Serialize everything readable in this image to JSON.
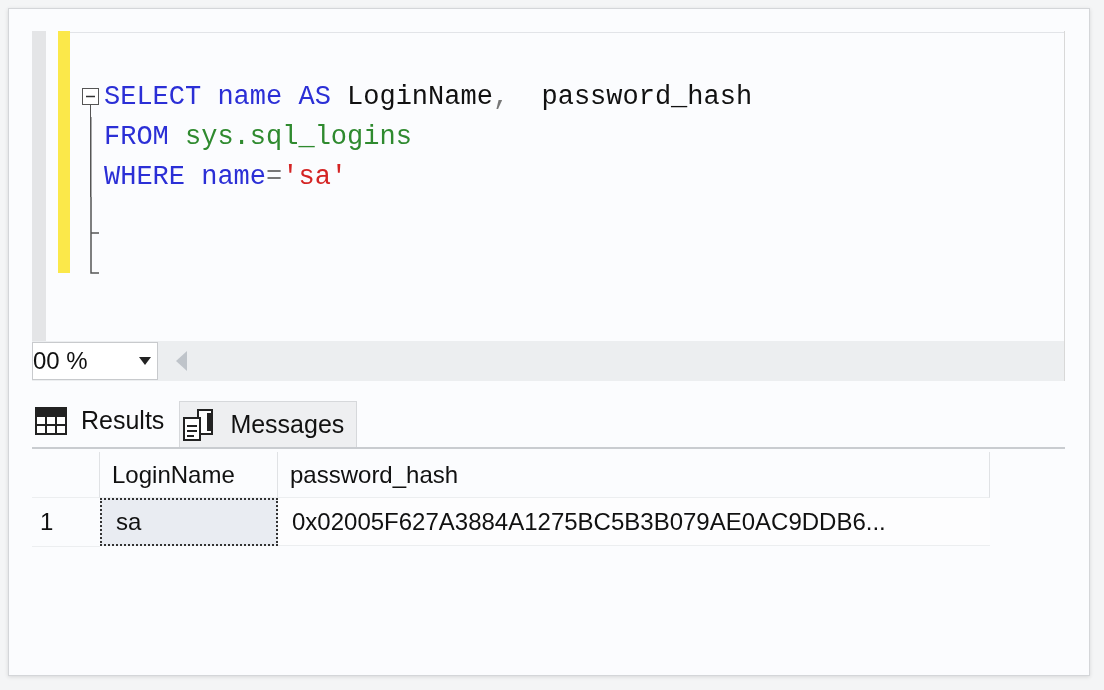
{
  "editor": {
    "lines": [
      {
        "fold_start": true,
        "tokens": [
          {
            "kind": "keyword",
            "text": "SELECT"
          },
          {
            "kind": "keyword",
            "text": " name"
          },
          {
            "kind": "keyword",
            "text": " AS"
          },
          {
            "kind": "plain",
            "text": " LoginName"
          },
          {
            "kind": "operator",
            "text": ","
          },
          {
            "kind": "plain",
            "text": "  password_hash"
          }
        ]
      },
      {
        "fold_start": false,
        "tokens": [
          {
            "kind": "keyword",
            "text": "FROM"
          },
          {
            "kind": "system",
            "text": " sys.sql_logins"
          }
        ]
      },
      {
        "fold_start": false,
        "tokens": [
          {
            "kind": "keyword",
            "text": "WHERE"
          },
          {
            "kind": "keyword",
            "text": " name"
          },
          {
            "kind": "operator",
            "text": "="
          },
          {
            "kind": "string",
            "text": "'sa'"
          }
        ]
      }
    ]
  },
  "zoom": {
    "value": "00 %"
  },
  "result_tabs": [
    {
      "label": "Results",
      "kind": "grid",
      "selected": true
    },
    {
      "label": "Messages",
      "kind": "messages",
      "selected": false
    }
  ],
  "grid": {
    "columns": [
      "LoginName",
      "password_hash"
    ],
    "rows": [
      {
        "number": "1",
        "cells": [
          {
            "text": "sa",
            "selected": true
          },
          {
            "text": "0x02005F627A3884A1275BC5B3B079AE0AC9DDB6...",
            "selected": false
          }
        ]
      }
    ]
  }
}
